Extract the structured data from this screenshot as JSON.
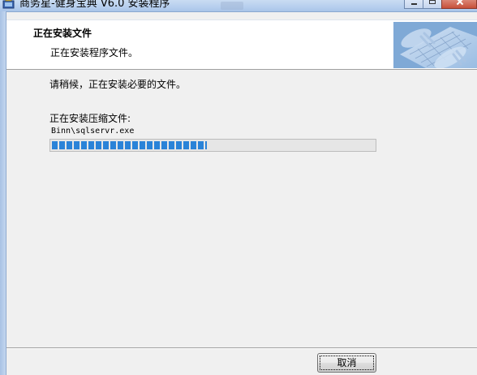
{
  "window": {
    "title": "商务星-健身宝典 V6.0 安装程序"
  },
  "header": {
    "title": "正在安装文件",
    "subtitle": "正在安装程序文件。",
    "image_icon": "keyboard-hands-photo"
  },
  "body": {
    "wait_message": "请稍候，正在安装必要的文件。",
    "extract_label": "正在安装压缩文件:",
    "current_file": "Binn\\sqlservr.exe"
  },
  "progress": {
    "fraction": 0.48
  },
  "buttons": {
    "cancel_label": "取消"
  },
  "colors": {
    "progress_fill": "#2a83d8",
    "dialog_background": "#f0f0f0",
    "header_background": "#ffffff"
  }
}
